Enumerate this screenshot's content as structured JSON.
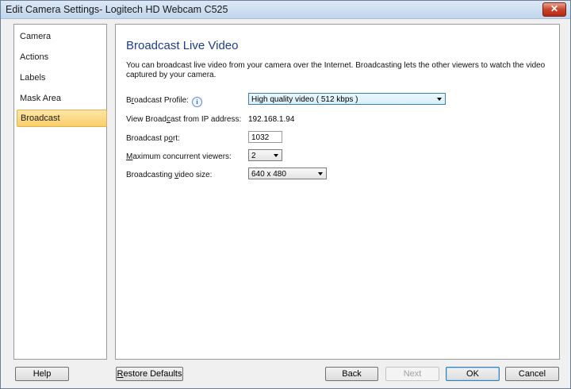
{
  "window": {
    "title": "Edit Camera Settings- Logitech HD Webcam C525",
    "close_label": "✕"
  },
  "sidebar": {
    "items": [
      {
        "label": "Camera"
      },
      {
        "label": "Actions"
      },
      {
        "label": "Labels"
      },
      {
        "label": "Mask Area"
      },
      {
        "label": "Broadcast",
        "active": true
      }
    ]
  },
  "main": {
    "heading": "Broadcast Live Video",
    "description": "You can broadcast live video from your camera over the Internet. Broadcasting lets the other viewers to watch the video captured by your camera.",
    "profile": {
      "label_pre": "B",
      "label_u": "r",
      "label_post": "oadcast Profile:",
      "info_icon": "i",
      "value": "High quality video ( 512 kbps )"
    },
    "ip": {
      "label_pre": "View Broad",
      "label_u": "c",
      "label_post": "ast from IP address:",
      "value": "192.168.1.94"
    },
    "port": {
      "label_pre": "Broadcast p",
      "label_u": "o",
      "label_post": "rt:",
      "value": "1032"
    },
    "viewers": {
      "label_pre": "",
      "label_u": "M",
      "label_post": "aximum concurrent viewers:",
      "value": "2"
    },
    "size": {
      "label_pre": "Broadcasting ",
      "label_u": "v",
      "label_post": "ideo size:",
      "value": "640 x 480"
    }
  },
  "buttons": {
    "help": "Help",
    "restore_pre": "",
    "restore_u": "R",
    "restore_post": "estore Defaults",
    "back": "Back",
    "next": "Next",
    "ok": "OK",
    "cancel": "Cancel"
  }
}
